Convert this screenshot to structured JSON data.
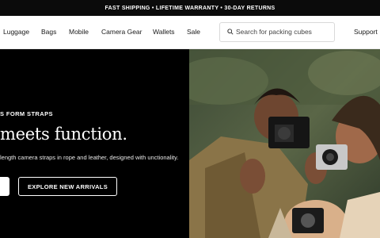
{
  "promo": {
    "text": "FAST SHIPPING • LIFETIME WARRANTY • 30-DAY RETURNS"
  },
  "nav": {
    "items": [
      "Luggage",
      "Bags",
      "Mobile",
      "Camera Gear",
      "Wallets",
      "Sale"
    ],
    "search_placeholder": "Search for packing cubes",
    "support": "Support"
  },
  "hero": {
    "eyebrow": "S FORM STRAPS",
    "headline": "meets function.",
    "description": "length camera straps in rope and leather, designed with unctionality.",
    "cta_secondary": "EXPLORE NEW ARRIVALS",
    "image_icon": "lifestyle-photo-people-with-cameras"
  },
  "colors": {
    "promo_bg": "#0b0b0b",
    "hero_bg": "#000000",
    "text": "#1a1a1a"
  }
}
